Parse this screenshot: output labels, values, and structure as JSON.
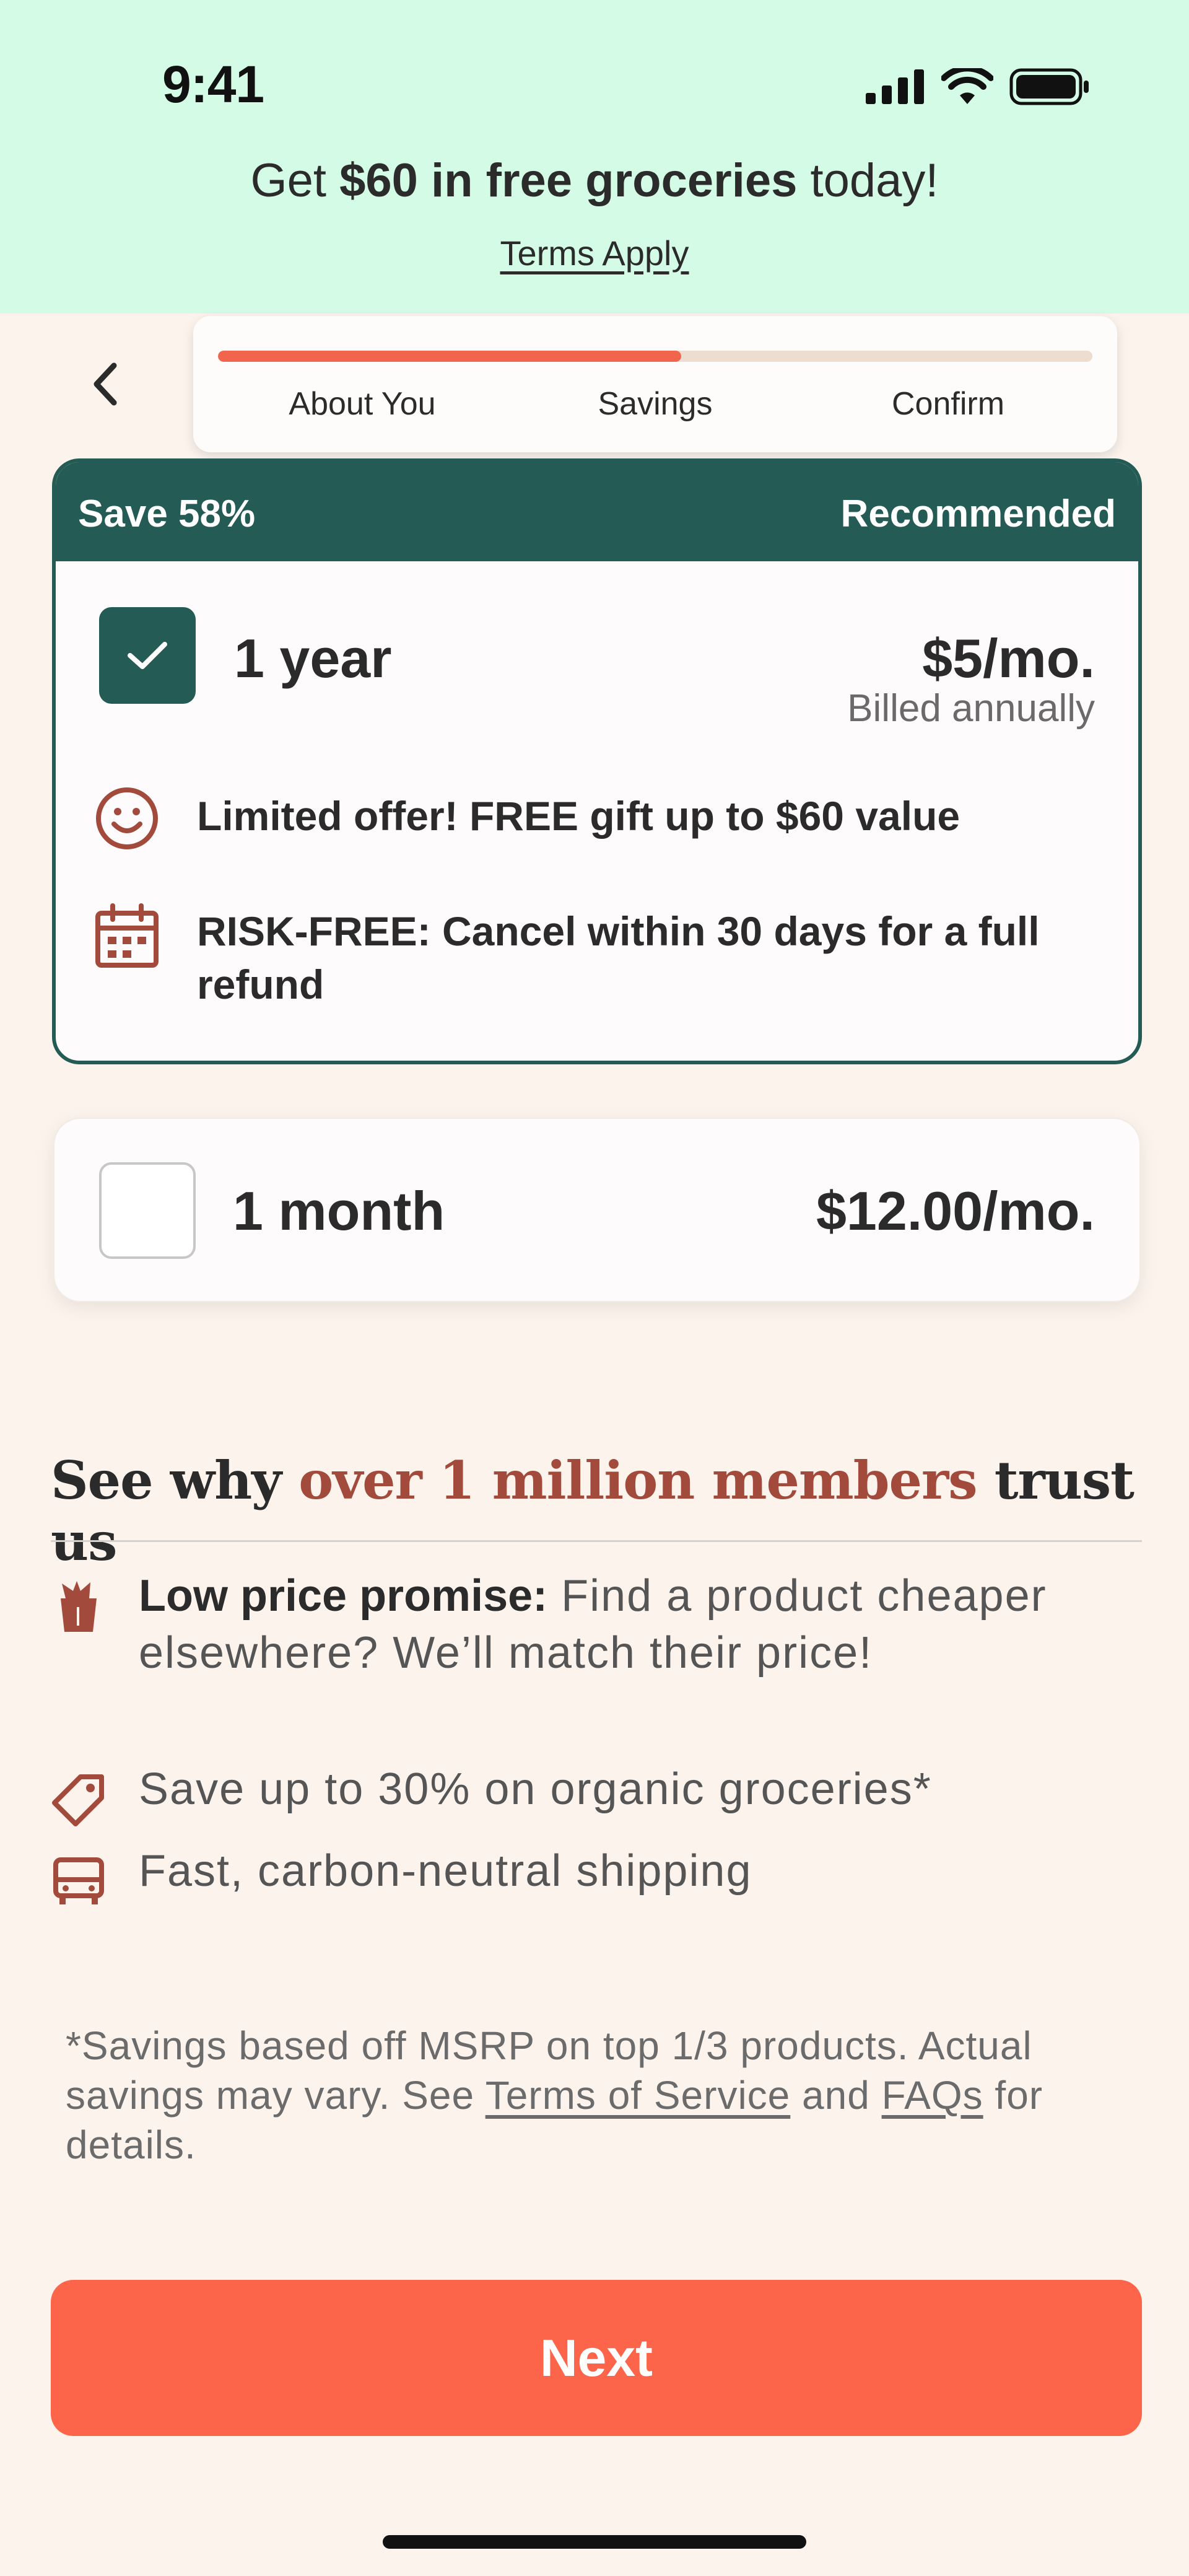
{
  "status_bar": {
    "time": "9:41"
  },
  "promo": {
    "prefix": "Get ",
    "highlight": "$60 in free groceries",
    "suffix": " today!",
    "terms_link": "Terms Apply"
  },
  "progress": {
    "value_fraction": 0.53,
    "steps": [
      "About You",
      "Savings",
      "Confirm"
    ]
  },
  "plans": {
    "year": {
      "ribbon_left": "Save 58%",
      "ribbon_right": "Recommended",
      "name": "1 year",
      "price": "$5/mo.",
      "billed": "Billed annually",
      "selected": true,
      "benefits": [
        {
          "icon": "smile-icon",
          "text": "Limited offer! FREE gift up to $60 value"
        },
        {
          "icon": "calendar-icon",
          "text": "RISK-FREE: Cancel within 30 days for a full refund"
        }
      ]
    },
    "month": {
      "name": "1 month",
      "price": "$12.00/mo.",
      "selected": false
    }
  },
  "trust": {
    "title_prefix": "See why ",
    "title_accent": "over 1 million members",
    "title_suffix": " trust us",
    "items": [
      {
        "icon": "grocery-bag-icon",
        "bold": "Low price promise:",
        "text": " Find a product cheaper elsewhere? We’ll match their price!"
      },
      {
        "icon": "price-tag-icon",
        "bold": "",
        "text": "Save up to 30% on organic groceries*"
      },
      {
        "icon": "truck-icon",
        "bold": "",
        "text": "Fast, carbon-neutral shipping"
      }
    ]
  },
  "footnote": {
    "part1": "*Savings based off MSRP on top 1/3 products. Actual savings may vary. See ",
    "link1": "Terms of Service",
    "part2": " and ",
    "link2": "FAQs",
    "part3": " for details."
  },
  "cta": {
    "next_label": "Next"
  },
  "colors": {
    "promo_bg": "#d3fbe5",
    "page_bg": "#fbf3ec",
    "brand_green": "#255b55",
    "accent_orange": "#fd654b",
    "progress_fill": "#f1654c",
    "icon_brown": "#a24a3b"
  }
}
